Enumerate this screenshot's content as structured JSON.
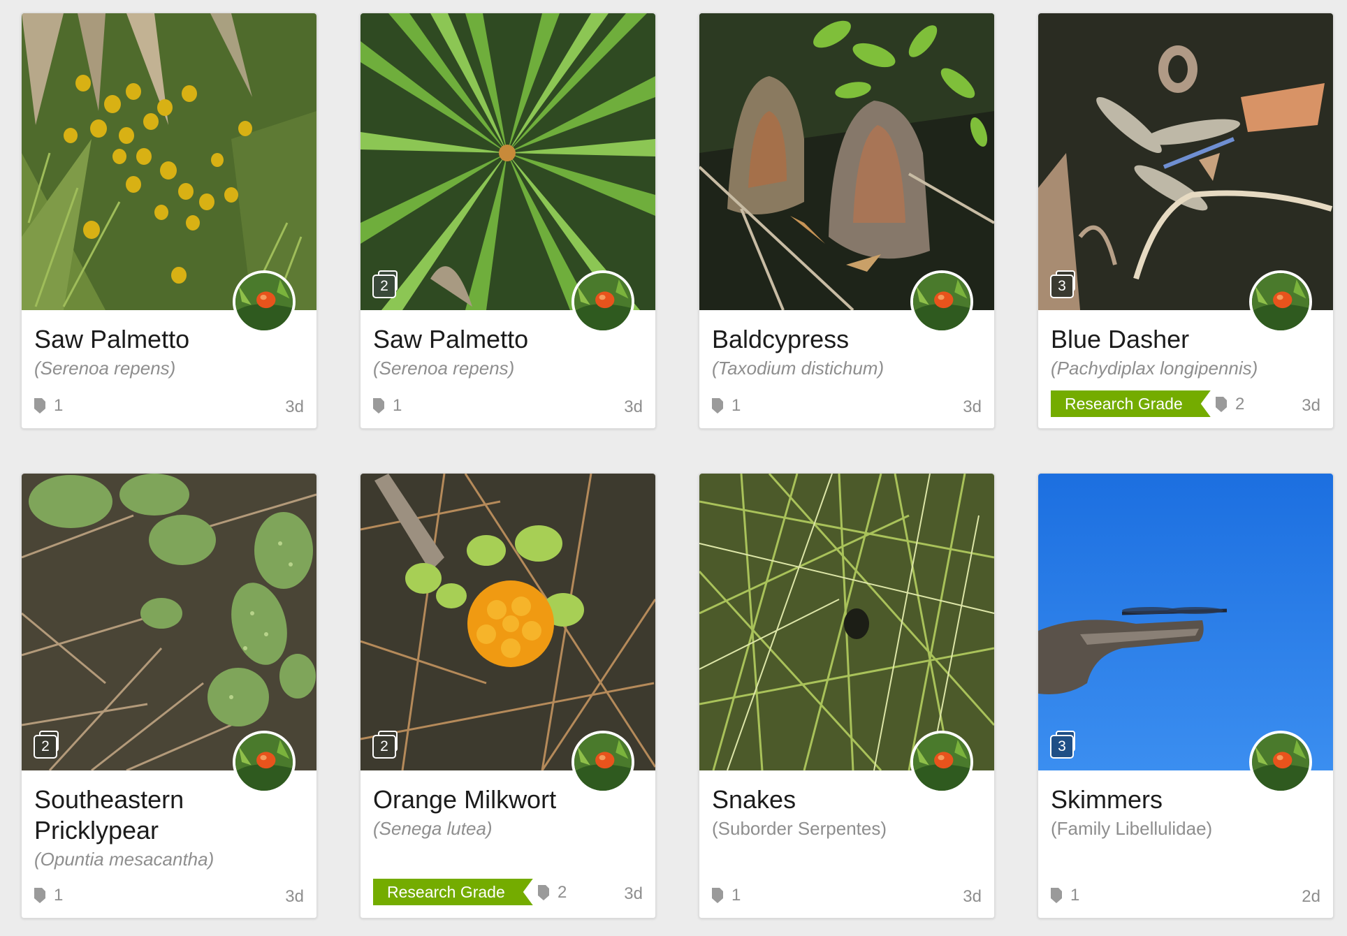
{
  "observations": [
    {
      "common_name": "Saw Palmetto",
      "scientific_name": "(Serenoa repens)",
      "photo_count": "",
      "quality_grade": "",
      "identifications": "1",
      "age": "3d",
      "scene": "palmetto-fruit"
    },
    {
      "common_name": "Saw Palmetto",
      "scientific_name": "(Serenoa repens)",
      "photo_count": "2",
      "quality_grade": "",
      "identifications": "1",
      "age": "3d",
      "scene": "palmetto-leaves"
    },
    {
      "common_name": "Baldcypress",
      "scientific_name": "(Taxodium distichum)",
      "photo_count": "",
      "quality_grade": "",
      "identifications": "1",
      "age": "3d",
      "scene": "cypress-knees"
    },
    {
      "common_name": "Blue Dasher",
      "scientific_name": "(Pachydiplax longipennis)",
      "photo_count": "3",
      "quality_grade": "Research Grade",
      "identifications": "2",
      "age": "3d",
      "scene": "dragonfly-water"
    },
    {
      "common_name": "Southeastern Pricklypear",
      "scientific_name": "(Opuntia mesacantha)",
      "photo_count": "2",
      "quality_grade": "",
      "identifications": "1",
      "age": "3d",
      "scene": "cactus"
    },
    {
      "common_name": "Orange Milkwort",
      "scientific_name": "(Senega lutea)",
      "photo_count": "2",
      "quality_grade": "Research Grade",
      "identifications": "2",
      "age": "3d",
      "scene": "orange-flower"
    },
    {
      "common_name": "Snakes",
      "scientific_name": "(Suborder Serpentes)",
      "photo_count": "",
      "quality_grade": "",
      "identifications": "1",
      "age": "3d",
      "scene": "grass"
    },
    {
      "common_name": "Skimmers",
      "scientific_name": "(Family Libellulidae)",
      "photo_count": "3",
      "quality_grade": "",
      "identifications": "1",
      "age": "2d",
      "scene": "sky-dragonfly"
    }
  ],
  "icons": {
    "identification": "identification-shield-icon",
    "photo_count": "photo-stack-icon",
    "avatar": "user-avatar"
  },
  "colors": {
    "research_grade": "#74ac00",
    "count_badge_dark": "#3a4a3a",
    "count_badge_blue": "#1f4f86"
  }
}
